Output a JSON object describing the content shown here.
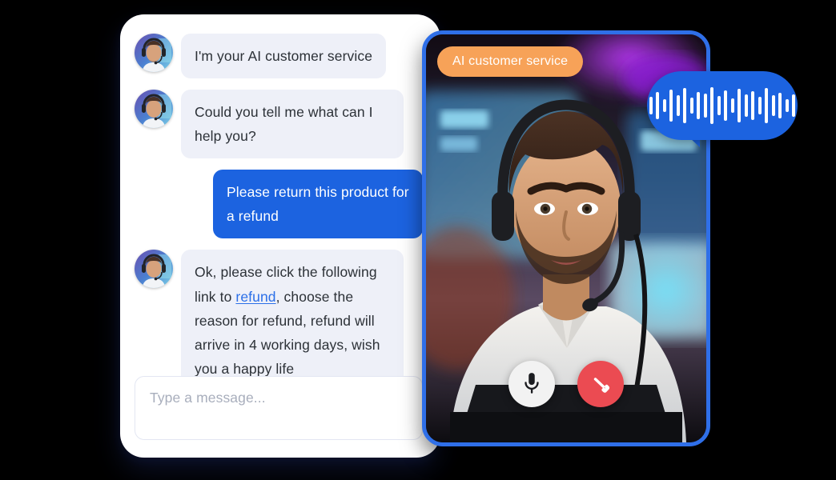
{
  "chat": {
    "messages": [
      {
        "side": "in",
        "text": "I'm your AI customer service",
        "avatar": "agent-avatar"
      },
      {
        "side": "in",
        "text": "Could you tell me what can I help you?",
        "avatar": "agent-avatar"
      },
      {
        "side": "out",
        "text": "Please return this product for a refund"
      },
      {
        "side": "in",
        "avatar": "agent-avatar",
        "rich": true,
        "text_before": "Ok, please click the following link to ",
        "link_text": "refund",
        "text_after": ", choose the reason for refund, refund will arrive in 4 working days, wish you a happy life"
      }
    ],
    "composer": {
      "placeholder": "Type a message...",
      "value": ""
    }
  },
  "video": {
    "badge_label": "AI customer service",
    "controls": [
      {
        "name": "microphone-button",
        "icon": "microphone-icon",
        "color": "#f2f2f2"
      },
      {
        "name": "end-call-button",
        "icon": "phone-hangup-icon",
        "color": "#eb4b52"
      }
    ]
  },
  "voice_bubble": {
    "icon": "audio-waveform-icon",
    "bars": [
      22,
      34,
      16,
      40,
      26,
      44,
      20,
      34,
      30,
      46,
      24,
      38,
      18,
      42,
      28,
      36,
      22,
      44,
      26,
      32,
      16,
      28
    ]
  },
  "colors": {
    "accent_blue": "#1c63e0",
    "border_blue": "#2f6fe8",
    "badge_orange": "#f7a258",
    "hangup_red": "#eb4b52",
    "bubble_in": "#eef0f8",
    "link_blue": "#2b6fe8"
  }
}
